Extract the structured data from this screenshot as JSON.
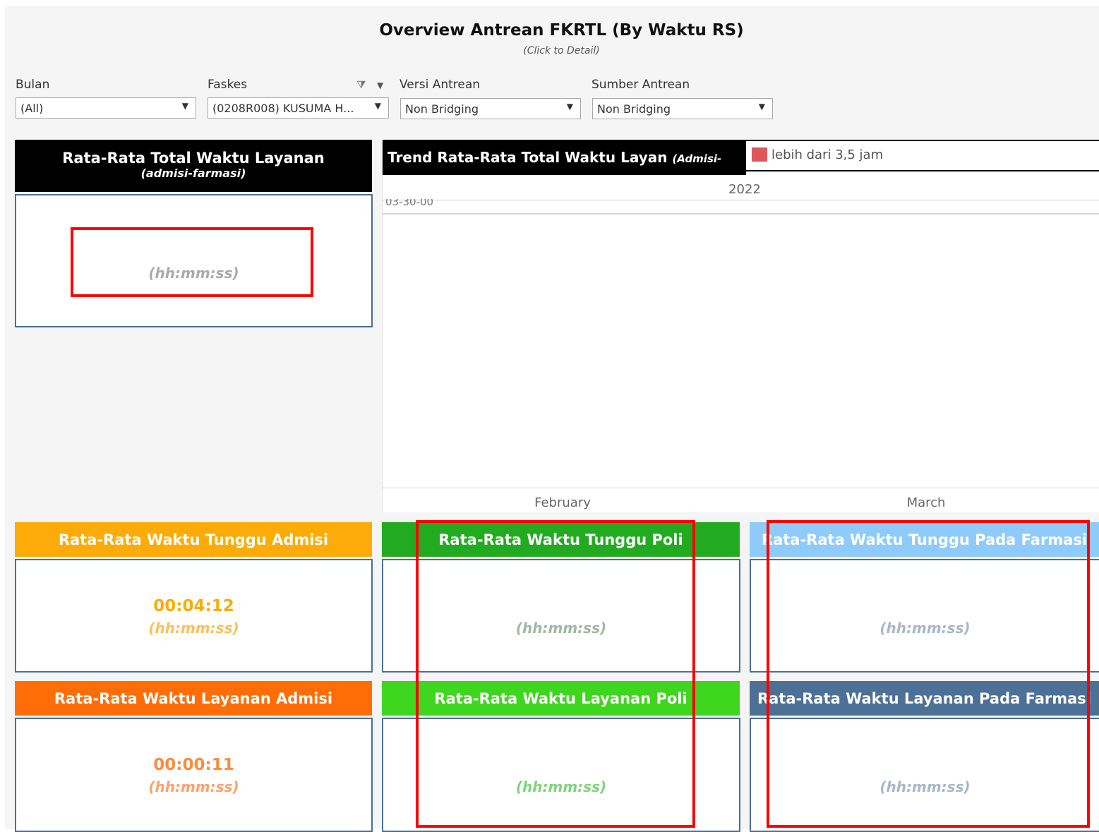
{
  "title": "Overview Antrean FKRTL (By Waktu RS)",
  "subtitle": "(Click to Detail)",
  "filters": {
    "bulan": {
      "label": "Bulan",
      "value": "(All)"
    },
    "faskes": {
      "label": "Faskes",
      "value": "(0208R008) KUSUMA H..."
    },
    "versi": {
      "label": "Versi Antrean",
      "value": "Non Bridging"
    },
    "sumber": {
      "label": "Sumber Antrean",
      "value": "Non Bridging"
    }
  },
  "total": {
    "title": "Rata-Rata Total Waktu Layanan",
    "subtitle": "(admisi-farmasi)",
    "unit": "(hh:mm:ss)"
  },
  "trend": {
    "title": "Trend Rata-Rata Total Waktu Layan",
    "title_italic": "(Admisi-Farmasi)",
    "legend": "lebih dari 3,5 jam",
    "year": "2022",
    "yaxis_label": "03-30-00",
    "months": [
      "February",
      "March"
    ]
  },
  "kpis": {
    "tunggu_admisi": {
      "title": "Rata-Rata Waktu Tunggu Admisi",
      "value": "00:04:12",
      "unit": "(hh:mm:ss)"
    },
    "tunggu_poli": {
      "title": "Rata-Rata Waktu Tunggu Poli",
      "value": "",
      "unit": "(hh:mm:ss)"
    },
    "tunggu_farmasi": {
      "title": "Rata-Rata Waktu Tunggu Pada Farmasi",
      "value": "",
      "unit": "(hh:mm:ss)"
    },
    "layanan_admisi": {
      "title": "Rata-Rata Waktu Layanan Admisi",
      "value": "00:00:11",
      "unit": "(hh:mm:ss)"
    },
    "layanan_poli": {
      "title": "Rata-Rata Waktu Layanan Poli",
      "value": "",
      "unit": "(hh:mm:ss)"
    },
    "layanan_farmasi": {
      "title": "Rata-Rata Waktu Layanan Pada Farmasi",
      "value": "",
      "unit": "(hh:mm:ss)"
    }
  },
  "colors": {
    "tunggu_admisi": "#fdab08",
    "layanan_admisi": "#ff6e06",
    "tunggu_poli": "#22ab20",
    "layanan_poli": "#3ed61f",
    "tunggu_farmasi": "#8ecbfa",
    "layanan_farmasi": "#4d7096",
    "highlight": "#ff0000"
  }
}
